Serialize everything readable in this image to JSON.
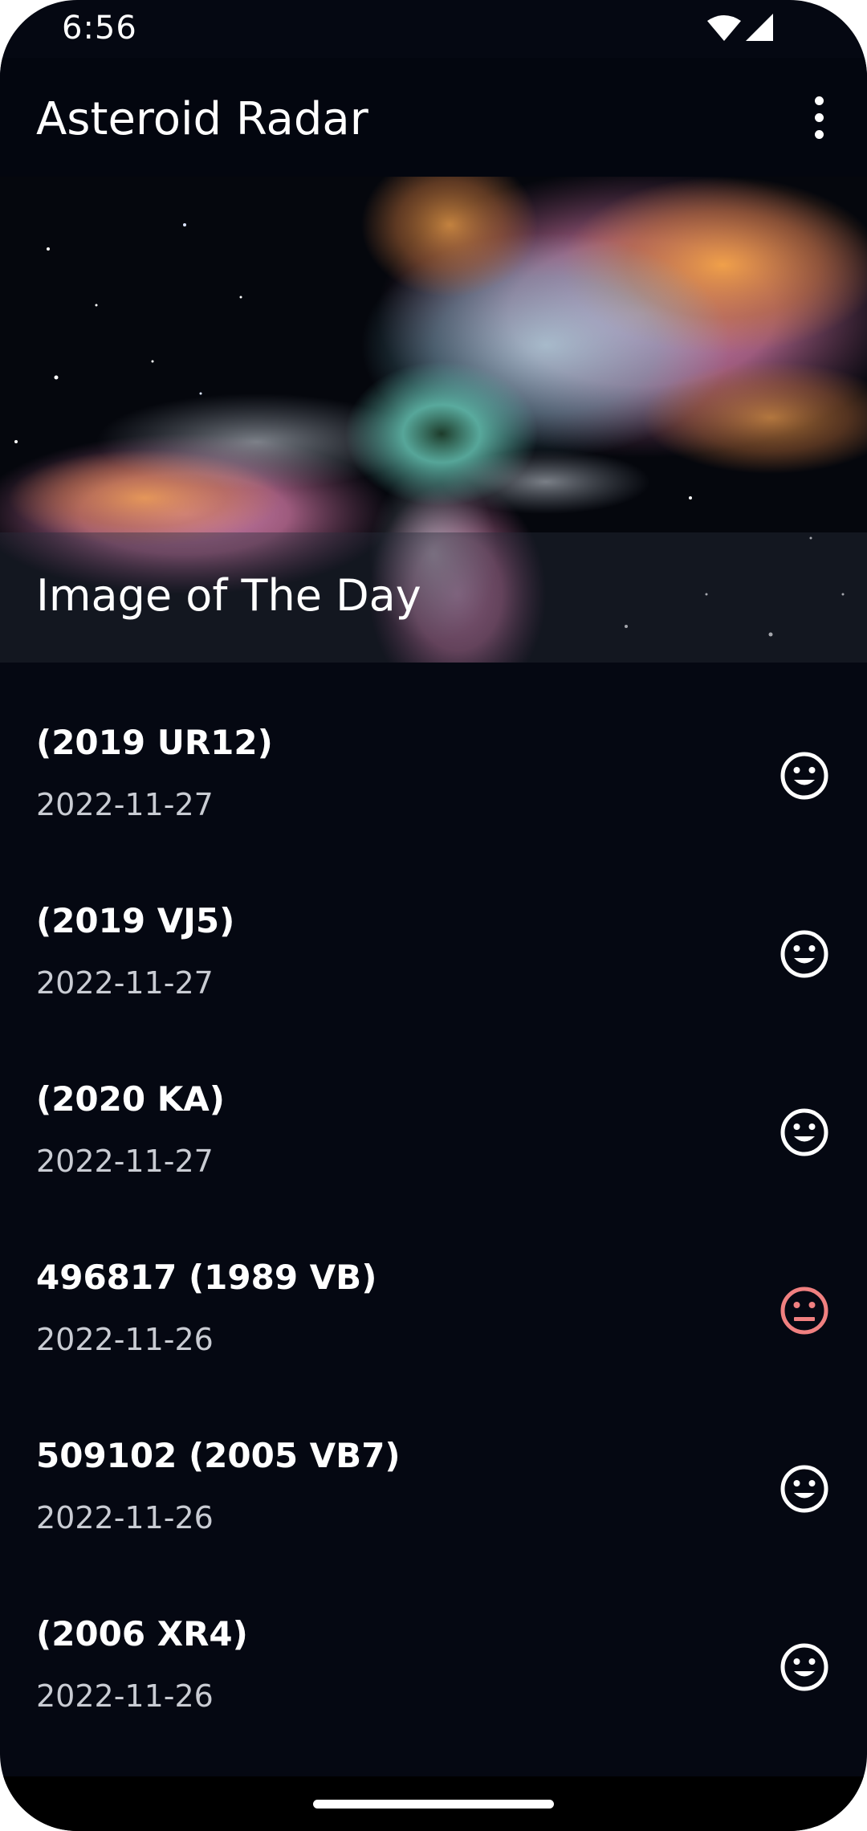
{
  "status_bar": {
    "time": "6:56",
    "icons": [
      "wifi-icon",
      "signal-icon"
    ]
  },
  "app_bar": {
    "title": "Asteroid Radar",
    "menu_icon": "more-vert-icon"
  },
  "image_of_day": {
    "title": "Image of The Day"
  },
  "asteroids": [
    {
      "name": "(2019 UR12)",
      "date": "2022-11-27",
      "hazardous": false
    },
    {
      "name": "(2019 VJ5)",
      "date": "2022-11-27",
      "hazardous": false
    },
    {
      "name": "(2020 KA)",
      "date": "2022-11-27",
      "hazardous": false
    },
    {
      "name": "496817 (1989 VB)",
      "date": "2022-11-26",
      "hazardous": true
    },
    {
      "name": "509102 (2005 VB7)",
      "date": "2022-11-26",
      "hazardous": false
    },
    {
      "name": "(2006 XR4)",
      "date": "2022-11-26",
      "hazardous": false
    }
  ],
  "colors": {
    "background": "#050812",
    "safe_icon": "#ffffff",
    "hazard_icon": "#f08080",
    "date_text": "#c9ccd3"
  }
}
